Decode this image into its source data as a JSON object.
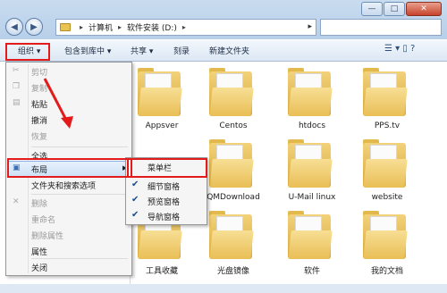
{
  "window": {
    "controls": [
      "minimize",
      "maximize",
      "close"
    ],
    "control_glyphs": [
      "—",
      "□",
      "✕"
    ]
  },
  "address": {
    "crumbs": [
      "计算机",
      "软件安装 (D:)"
    ],
    "sep": "▸",
    "end_arrow": "▸"
  },
  "toolbar": {
    "organize_label": "组织 ▾",
    "include_label": "包含到库中 ▾",
    "share_label": "共享 ▾",
    "burn_label": "刻录",
    "new_folder_label": "新建文件夹",
    "view_icons": "☰ ▾  ▯  ?"
  },
  "menu": {
    "items": [
      {
        "label": "剪切",
        "disabled": true
      },
      {
        "label": "复制",
        "disabled": true
      },
      {
        "label": "粘贴",
        "disabled": false
      },
      {
        "label": "撤消",
        "disabled": false
      },
      {
        "label": "恢复",
        "disabled": true
      },
      {
        "label": "全选",
        "disabled": false
      },
      {
        "label": "布局",
        "disabled": false
      },
      {
        "label": "文件夹和搜索选项",
        "disabled": false
      },
      {
        "label": "删除",
        "disabled": true
      },
      {
        "label": "重命名",
        "disabled": true
      },
      {
        "label": "删除属性",
        "disabled": true
      },
      {
        "label": "属性",
        "disabled": false
      },
      {
        "label": "关闭",
        "disabled": false
      }
    ]
  },
  "submenu": {
    "items": [
      {
        "label": "菜单栏",
        "checked": false
      },
      {
        "label": "细节窗格",
        "checked": true
      },
      {
        "label": "预览窗格",
        "checked": true
      },
      {
        "label": "导航窗格",
        "checked": true
      }
    ]
  },
  "folders": [
    {
      "label": ""
    },
    {
      "label": "Appsver"
    },
    {
      "label": "Centos"
    },
    {
      "label": "htdocs"
    },
    {
      "label": "PPS.tv"
    },
    {
      "label": "QMDownload"
    },
    {
      "label": "U-Mail linux"
    },
    {
      "label": "website"
    },
    {
      "label": "工具收藏"
    },
    {
      "label": "光盘镜像"
    },
    {
      "label": "软件"
    },
    {
      "label": "我的文档"
    }
  ],
  "colors": {
    "highlight": "#e31b1b",
    "folder": "#e9bf56"
  }
}
